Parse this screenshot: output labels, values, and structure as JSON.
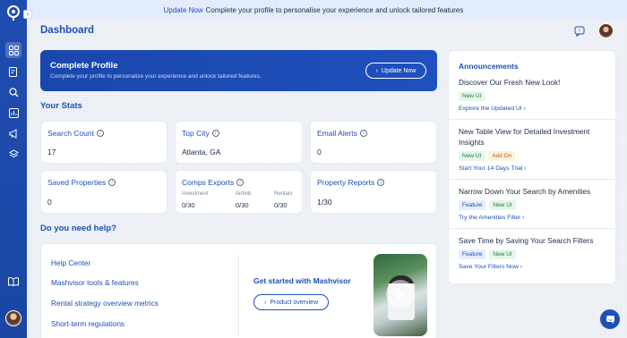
{
  "banner": {
    "link": "Update Now",
    "text": "Complete your profile to personalise your experience and unlock tailored features"
  },
  "header": {
    "title": "Dashboard"
  },
  "profile": {
    "title": "Complete Profile",
    "subtitle": "Complete your profile to personalize your experience and unlock tailored features.",
    "button": "Update Now"
  },
  "stats": {
    "title": "Your Stats",
    "search_count": {
      "label": "Search Count",
      "value": "17"
    },
    "top_city": {
      "label": "Top City",
      "value": "Atlanta, GA"
    },
    "email_alerts": {
      "label": "Email Alerts",
      "value": "0"
    },
    "saved_properties": {
      "label": "Saved Properties",
      "value": "0"
    },
    "comps_exports": {
      "label": "Comps Exports",
      "columns": [
        {
          "name": "Investment",
          "value": "0/30"
        },
        {
          "name": "Airbnb",
          "value": "0/30"
        },
        {
          "name": "Rentals",
          "value": "0/30"
        }
      ]
    },
    "property_reports": {
      "label": "Property Reports",
      "value": "1/30"
    }
  },
  "help": {
    "title": "Do you need help?",
    "links": [
      "Help Center",
      "Mashvisor tools & features",
      "Rental strategy overview metrics",
      "Short-term regulations"
    ],
    "get_started": "Get started with Mashvisor",
    "button": "Product overview"
  },
  "announcements": {
    "title": "Announcements",
    "items": [
      {
        "title": "Discover Our Fresh New Look!",
        "tags": [
          "New UI"
        ],
        "link": "Explore the Updated UI"
      },
      {
        "title": "New Table View for Detailed Investment Insights",
        "tags": [
          "New UI",
          "Add On"
        ],
        "link": "Start Your 14 Days Trial"
      },
      {
        "title": "Narrow Down Your Search by Amenities",
        "tags": [
          "Feature",
          "New UI"
        ],
        "link": "Try the Amenities Filter"
      },
      {
        "title": "Save Time by Saving Your Search Filters",
        "tags": [
          "Feature",
          "New UI"
        ],
        "link": "Save Your Filters Now"
      }
    ]
  },
  "sidebar": {
    "icons": [
      "dashboard-icon",
      "reports-icon",
      "search-icon",
      "analytics-icon",
      "megaphone-icon",
      "layers-icon",
      "book-icon"
    ]
  },
  "colors": {
    "accent": "#1d4fb8",
    "sidebar": "#1f4db0"
  }
}
